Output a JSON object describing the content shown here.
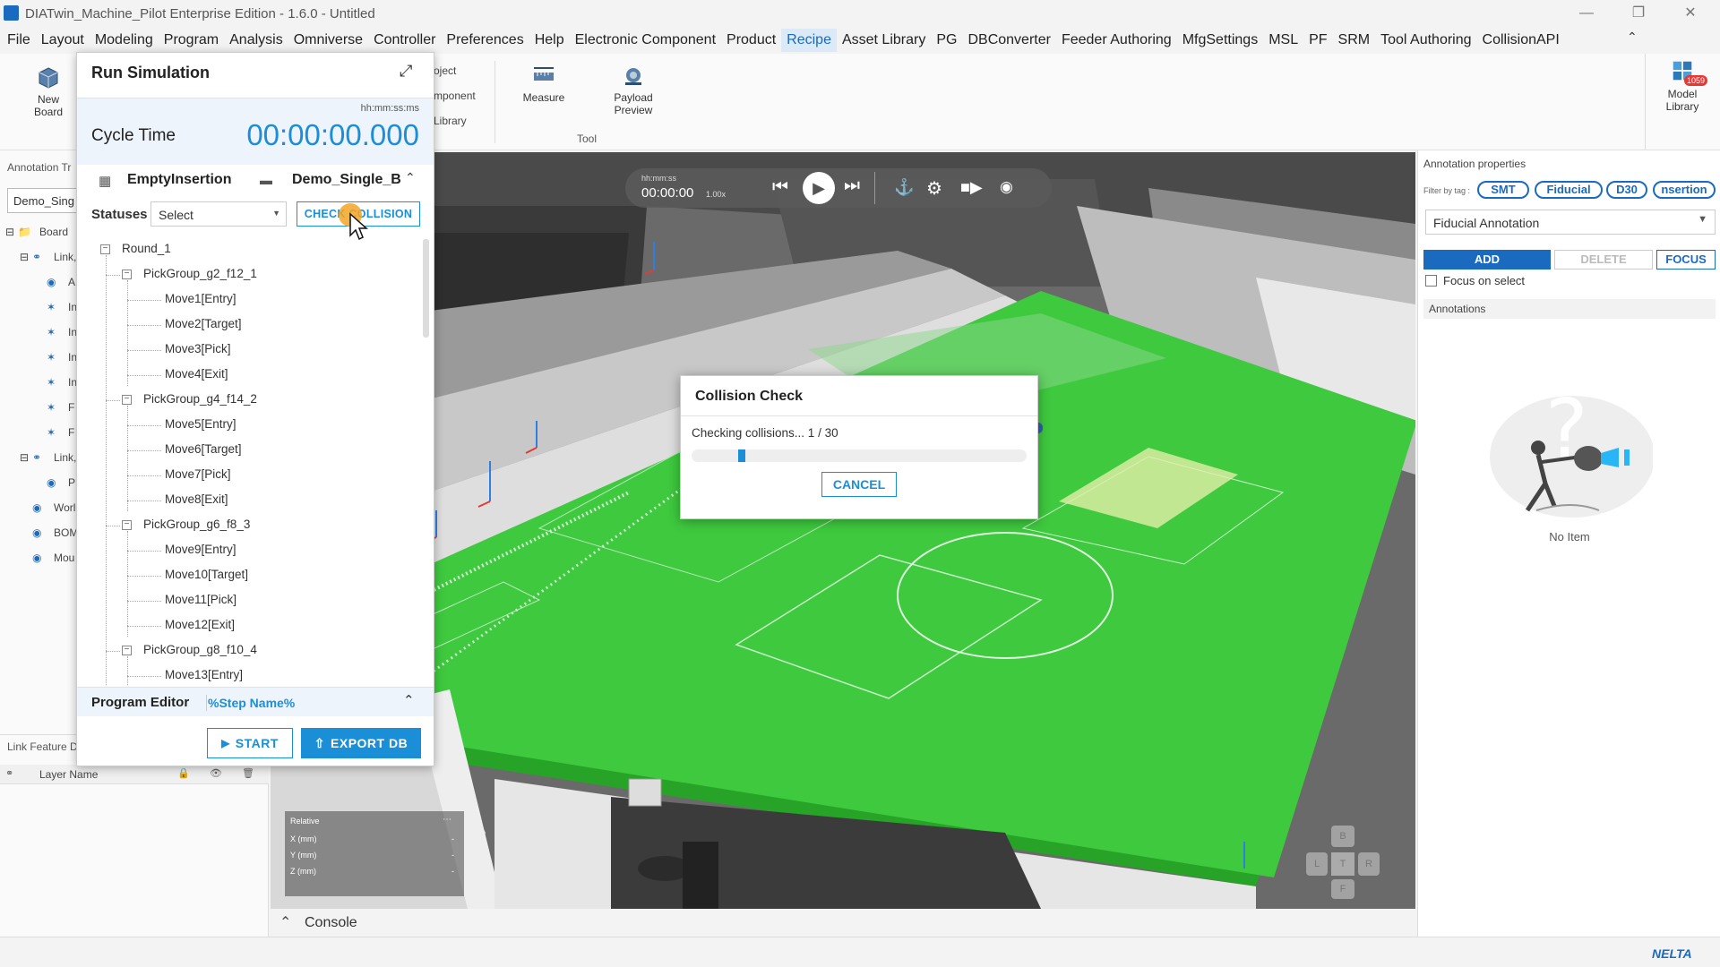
{
  "window": {
    "title": "DIATwin_Machine_Pilot Enterprise Edition - 1.6.0 - Untitled"
  },
  "menu": [
    "File",
    "Layout",
    "Modeling",
    "Program",
    "Analysis",
    "Omniverse",
    "Controller",
    "Preferences",
    "Help",
    "Electronic Component",
    "Product",
    "Recipe",
    "Asset Library",
    "PG",
    "DBConverter",
    "Feeder Authoring",
    "MfgSettings",
    "MSL",
    "PF",
    "SRM",
    "Tool Authoring",
    "CollisionAPI"
  ],
  "menu_active": "Recipe",
  "ribbon": {
    "new_board": "New\nBoard",
    "partial_1": "oject",
    "partial_2": "mponent",
    "partial_3": "Library",
    "measure": "Measure",
    "payload_preview": "Payload\nPreview",
    "tool_group": "Tool",
    "model_library": "Model\nLibrary",
    "model_library_badge": "1059"
  },
  "left_panel": {
    "annotation_tree_label": "Annotation Tr",
    "search_value": "Demo_Sing",
    "tree": [
      "Board",
      "Link,",
      "A",
      "In",
      "In",
      "In",
      "In",
      "F",
      "F",
      "Link,",
      "P",
      "Worl",
      "BOM",
      "Mou"
    ],
    "link_feature_label": "Link Feature D",
    "layer_name_header": "Layer Name"
  },
  "run_simulation": {
    "title": "Run Simulation",
    "time_format": "hh:mm:ss:ms",
    "cycle_time_label": "Cycle Time",
    "cycle_time_value": "00:00:00.000",
    "program_name": "EmptyInsertion",
    "board_name": "Demo_Single_B",
    "statuses_label": "Statuses",
    "statuses_select": "Select",
    "check_collision": "CHECK COLLISION",
    "round": "Round_1",
    "groups": [
      {
        "name": "PickGroup_g2_f12_1",
        "moves": [
          "Move1[Entry]",
          "Move2[Target]",
          "Move3[Pick]",
          "Move4[Exit]"
        ]
      },
      {
        "name": "PickGroup_g4_f14_2",
        "moves": [
          "Move5[Entry]",
          "Move6[Target]",
          "Move7[Pick]",
          "Move8[Exit]"
        ]
      },
      {
        "name": "PickGroup_g6_f8_3",
        "moves": [
          "Move9[Entry]",
          "Move10[Target]",
          "Move11[Pick]",
          "Move12[Exit]"
        ]
      },
      {
        "name": "PickGroup_g8_f10_4",
        "moves": [
          "Move13[Entry]"
        ]
      }
    ],
    "program_editor_label": "Program Editor",
    "step_name": "%Step Name%",
    "start": "START",
    "export_db": "EXPORT DB"
  },
  "playback": {
    "time_format": "hh:mm:ss",
    "time": "00:00:00",
    "speed": "1.00x"
  },
  "collision_dialog": {
    "title": "Collision Check",
    "message": "Checking collisions... 1 / 30",
    "progress": 0.0333,
    "cancel": "CANCEL"
  },
  "coords": {
    "relative": "Relative",
    "x": "X (mm)",
    "y": "Y (mm)",
    "z": "Z (mm)",
    "x_val": "-",
    "y_val": "-",
    "z_val": "-"
  },
  "view_cube": {
    "b": "B",
    "l": "L",
    "t": "T",
    "r": "R",
    "f": "F"
  },
  "right_panel": {
    "title": "Annotation properties",
    "filter_label": "Filter by tag :",
    "tags": [
      "SMT",
      "Fiducial",
      "D30",
      "nsertion"
    ],
    "annotation_type": "Fiducial Annotation",
    "add": "ADD",
    "delete": "DELETE",
    "focus": "FOCUS",
    "focus_on_select": "Focus on select",
    "annotations_header": "Annotations",
    "empty_text": "No Item"
  },
  "console": {
    "label": "Console"
  },
  "brand": "NELTA",
  "colors": {
    "accent": "#1a6bbf",
    "board_green": "#3ec93e",
    "highlight_orange": "#f5a623"
  }
}
